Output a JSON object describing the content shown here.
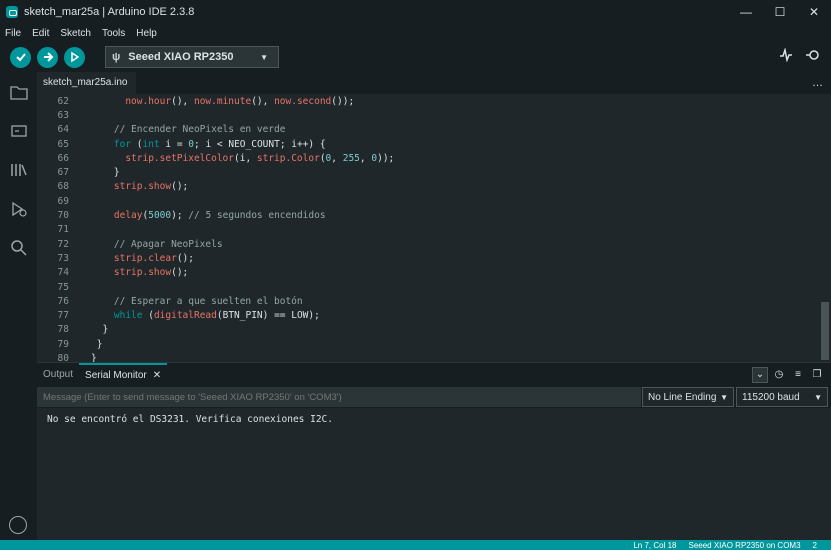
{
  "window": {
    "title": "sketch_mar25a | Arduino IDE 2.3.8",
    "controls": [
      "—",
      "☐",
      "✕"
    ]
  },
  "menu": [
    "File",
    "Edit",
    "Sketch",
    "Tools",
    "Help"
  ],
  "toolbar": {
    "board": "Seeed XIAO RP2350"
  },
  "tab": {
    "label": "sketch_mar25a.ino",
    "more": "…"
  },
  "code": [
    {
      "n": "62",
      "parts": [
        {
          "t": "      ",
          "c": ""
        },
        {
          "t": "now.hour",
          "c": "fn"
        },
        {
          "t": "(), ",
          "c": ""
        },
        {
          "t": "now.minute",
          "c": "fn"
        },
        {
          "t": "(), ",
          "c": ""
        },
        {
          "t": "now.second",
          "c": "fn"
        },
        {
          "t": "());",
          "c": ""
        }
      ]
    },
    {
      "n": "63",
      "parts": [
        {
          "t": "",
          "c": ""
        }
      ]
    },
    {
      "n": "64",
      "parts": [
        {
          "t": "    // Encender NeoPixels en verde",
          "c": "cmt"
        }
      ]
    },
    {
      "n": "65",
      "parts": [
        {
          "t": "    ",
          "c": ""
        },
        {
          "t": "for",
          "c": "kw"
        },
        {
          "t": " (",
          "c": ""
        },
        {
          "t": "int",
          "c": "kw"
        },
        {
          "t": " i = ",
          "c": ""
        },
        {
          "t": "0",
          "c": "num"
        },
        {
          "t": "; i < NEO_COUNT; i++) {",
          "c": ""
        }
      ]
    },
    {
      "n": "66",
      "parts": [
        {
          "t": "      ",
          "c": ""
        },
        {
          "t": "strip.setPixelColor",
          "c": "fn"
        },
        {
          "t": "(i, ",
          "c": ""
        },
        {
          "t": "strip.Color",
          "c": "fn"
        },
        {
          "t": "(",
          "c": ""
        },
        {
          "t": "0",
          "c": "num"
        },
        {
          "t": ", ",
          "c": ""
        },
        {
          "t": "255",
          "c": "num"
        },
        {
          "t": ", ",
          "c": ""
        },
        {
          "t": "0",
          "c": "num"
        },
        {
          "t": "));",
          "c": ""
        }
      ]
    },
    {
      "n": "67",
      "parts": [
        {
          "t": "    }",
          "c": ""
        }
      ]
    },
    {
      "n": "68",
      "parts": [
        {
          "t": "    ",
          "c": ""
        },
        {
          "t": "strip.show",
          "c": "fn"
        },
        {
          "t": "();",
          "c": ""
        }
      ]
    },
    {
      "n": "69",
      "parts": [
        {
          "t": "",
          "c": ""
        }
      ]
    },
    {
      "n": "70",
      "parts": [
        {
          "t": "    ",
          "c": ""
        },
        {
          "t": "delay",
          "c": "fn"
        },
        {
          "t": "(",
          "c": ""
        },
        {
          "t": "5000",
          "c": "num"
        },
        {
          "t": "); ",
          "c": ""
        },
        {
          "t": "// 5 segundos encendidos",
          "c": "cmt"
        }
      ]
    },
    {
      "n": "71",
      "parts": [
        {
          "t": "",
          "c": ""
        }
      ]
    },
    {
      "n": "72",
      "parts": [
        {
          "t": "    // Apagar NeoPixels",
          "c": "cmt"
        }
      ]
    },
    {
      "n": "73",
      "parts": [
        {
          "t": "    ",
          "c": ""
        },
        {
          "t": "strip.clear",
          "c": "fn"
        },
        {
          "t": "();",
          "c": ""
        }
      ]
    },
    {
      "n": "74",
      "parts": [
        {
          "t": "    ",
          "c": ""
        },
        {
          "t": "strip.show",
          "c": "fn"
        },
        {
          "t": "();",
          "c": ""
        }
      ]
    },
    {
      "n": "75",
      "parts": [
        {
          "t": "",
          "c": ""
        }
      ]
    },
    {
      "n": "76",
      "parts": [
        {
          "t": "    // Esperar a que suelten el botón",
          "c": "cmt"
        }
      ]
    },
    {
      "n": "77",
      "parts": [
        {
          "t": "    ",
          "c": ""
        },
        {
          "t": "while",
          "c": "kw"
        },
        {
          "t": " (",
          "c": ""
        },
        {
          "t": "digitalRead",
          "c": "fn"
        },
        {
          "t": "(BTN_PIN) == LOW);",
          "c": ""
        }
      ]
    },
    {
      "n": "78",
      "parts": [
        {
          "t": "  }",
          "c": ""
        }
      ]
    },
    {
      "n": "79",
      "parts": [
        {
          "t": " }",
          "c": ""
        }
      ]
    },
    {
      "n": "80",
      "parts": [
        {
          "t": "}",
          "c": ""
        }
      ]
    }
  ],
  "bottom_panel": {
    "tab_output": "Output",
    "tab_serial": "Serial Monitor",
    "close": "✕"
  },
  "serial": {
    "placeholder": "Message (Enter to send message to 'Seeed XIAO RP2350' on 'COM3')",
    "line_ending": "No Line Ending",
    "baud": "115200 baud",
    "output": "No se encontró el DS3231. Verifica conexiones I2C."
  },
  "status": {
    "position": "Ln 7, Col 18",
    "board": "Seeed XIAO RP2350 on COM3",
    "count": "2"
  },
  "colors": {
    "accent": "#00979c",
    "keyword": "#00979c",
    "function": "#e97366",
    "number": "#7fcbcd",
    "comment": "#95a5a6"
  }
}
